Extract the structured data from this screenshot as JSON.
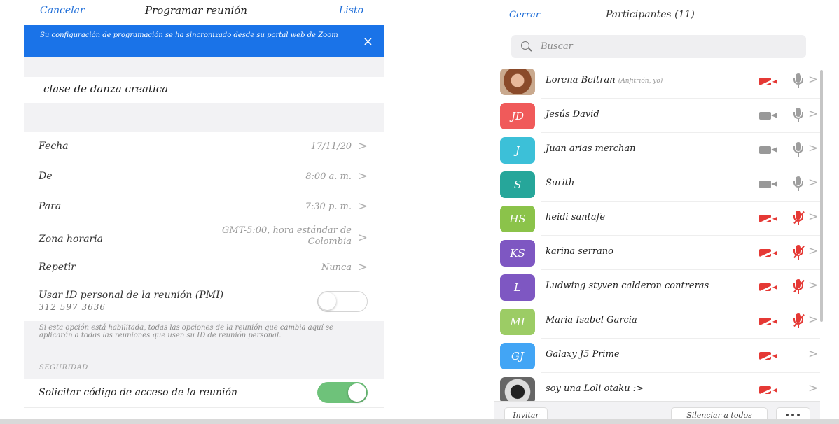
{
  "schedule": {
    "header": {
      "cancel_label": "Cancelar",
      "title": "Programar reunión",
      "done_label": "Listo"
    },
    "banner": {
      "message": "Su configuración de programación se ha sincronizado desde su portal web de Zoom",
      "close_icon": "×",
      "color": "#1a73e8"
    },
    "topic": "clase de danza creatica",
    "rows": {
      "fecha": {
        "label": "Fecha",
        "value": "17/11/20"
      },
      "de": {
        "label": "De",
        "value": "8:00 a. m."
      },
      "para": {
        "label": "Para",
        "value": "7:30 p. m."
      },
      "zona": {
        "label": "Zona horaria",
        "value_line1": "GMT-5:00, hora estándar de",
        "value_line2": "Colombia"
      },
      "repetir": {
        "label": "Repetir",
        "value": "Nunca"
      }
    },
    "pmi": {
      "label": "Usar ID personal de la reunión (PMI)",
      "id": "312 597 3636",
      "enabled": false
    },
    "note": "Si esta opción está habilitada, todas las opciones de la reunión que cambia aquí se aplicarán a todas las reuniones que usen su ID de reunión personal.",
    "security_header": "SEGURIDAD",
    "passcode": {
      "label": "Solicitar código de acceso de la reunión",
      "enabled": true,
      "toggle_color": "#6ec27a"
    },
    "chevron": ">"
  },
  "participants_panel": {
    "header": {
      "close_label": "Cerrar",
      "title": "Participantes (11)"
    },
    "search": {
      "placeholder": "Buscar",
      "icon": "search-icon"
    },
    "participants": [
      {
        "name": "Lorena Beltran",
        "tag": "(Anfitrión, yo)",
        "avatar": "",
        "avatar_type": "photo",
        "video": "off",
        "audio": "on"
      },
      {
        "name": "Jesús David",
        "avatar": "JD",
        "avatar_color": "#f05a5a",
        "video": "on",
        "audio": "on"
      },
      {
        "name": "Juan arias merchan",
        "avatar": "J",
        "avatar_color": "#3cc0d8",
        "video": "on",
        "audio": "on"
      },
      {
        "name": "Surith",
        "avatar": "S",
        "avatar_color": "#26a69a",
        "video": "on",
        "audio": "on"
      },
      {
        "name": "heidi santafe",
        "avatar": "HS",
        "avatar_color": "#8bc34a",
        "video": "off",
        "audio": "off"
      },
      {
        "name": "karina serrano",
        "avatar": "KS",
        "avatar_color": "#7e57c2",
        "video": "off",
        "audio": "off"
      },
      {
        "name": "Ludwing styven calderon contreras",
        "avatar": "L",
        "avatar_color": "#7e57c2",
        "video": "off",
        "audio": "off"
      },
      {
        "name": "Maria Isabel Garcia",
        "avatar": "MI",
        "avatar_color": "#9ccc65",
        "video": "off",
        "audio": "off"
      },
      {
        "name": "Galaxy J5 Prime",
        "avatar": "GJ",
        "avatar_color": "#42a5f5",
        "video": "off",
        "audio": "none"
      },
      {
        "name": "soy una Loli otaku :>",
        "avatar": "",
        "avatar_type": "photo",
        "video": "off",
        "audio": "none"
      }
    ],
    "footer": {
      "invite_label": "Invitar",
      "mute_all_label": "Silenciar a todos",
      "more_label": "•••"
    }
  }
}
